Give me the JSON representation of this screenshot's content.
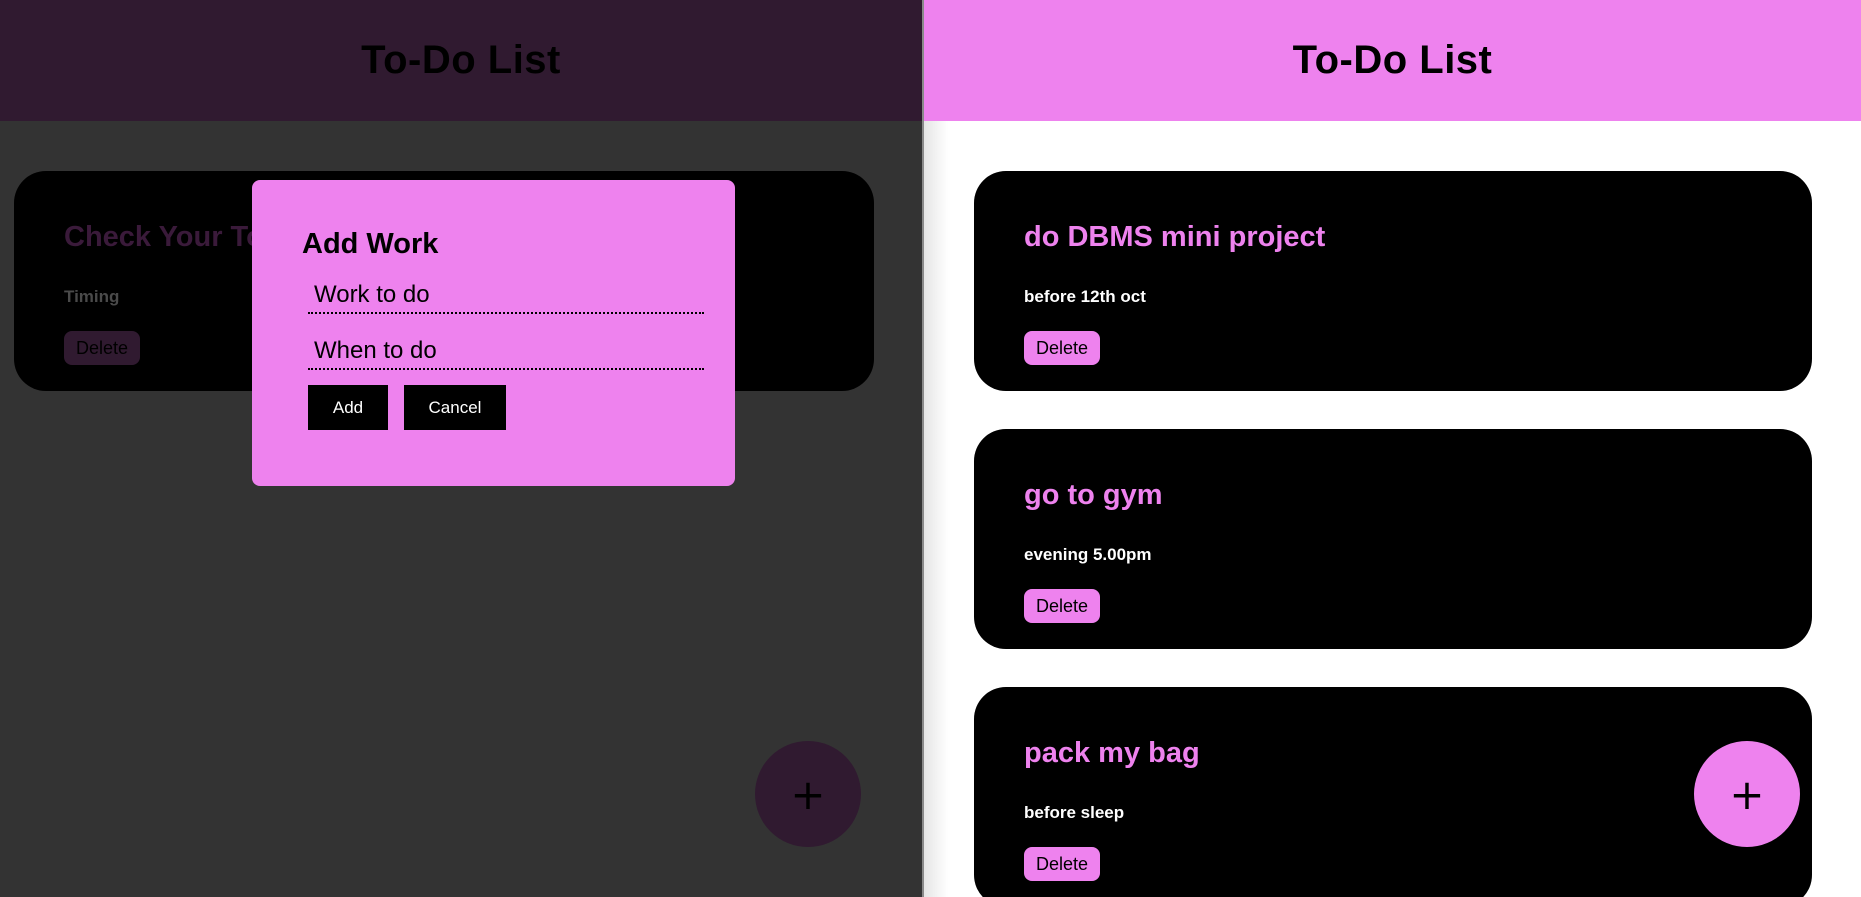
{
  "colors": {
    "accent": "#ee82ee",
    "card": "#000000",
    "overlay_bg": "#333333",
    "dim_header": "#301a30"
  },
  "left_view": {
    "header_title": "To-Do List",
    "card": {
      "title": "Check Your To",
      "timing": "Timing",
      "delete_label": "Delete"
    },
    "modal": {
      "title": "Add Work",
      "work_placeholder": "Work to do",
      "when_placeholder": "When to do",
      "add_label": "Add",
      "cancel_label": "Cancel"
    },
    "fab_icon": "plus-icon",
    "fab_label": "+"
  },
  "right_view": {
    "header_title": "To-Do List",
    "tasks": [
      {
        "title": "do DBMS mini project",
        "timing": "before 12th oct",
        "delete_label": "Delete"
      },
      {
        "title": "go to gym",
        "timing": "evening 5.00pm",
        "delete_label": "Delete"
      },
      {
        "title": "pack my bag",
        "timing": "before sleep",
        "delete_label": "Delete"
      }
    ],
    "fab_icon": "plus-icon",
    "fab_label": "+"
  }
}
